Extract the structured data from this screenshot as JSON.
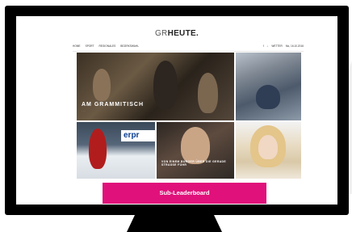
{
  "site": {
    "logo_prefix": "GR",
    "logo_main": "HEUTE."
  },
  "nav": {
    "items": [
      "HOME",
      "SPORT",
      "REGIONALES",
      "BEZIRKSWAHL"
    ],
    "right_icons": [
      "facebook-icon",
      "search-icon"
    ],
    "weather": "WETTER",
    "user": "Mo, 16.10.2016"
  },
  "tiles": [
    {
      "title": "AM GRAMMITISCH",
      "meta": "..."
    },
    {
      "title": "",
      "meta": ""
    },
    {
      "title": "",
      "meta": ""
    },
    {
      "title": "VON EINEM BURGER ÜBER DIE GERADE STRASSE FÜHR",
      "meta": ""
    },
    {
      "title": "",
      "meta": ""
    }
  ],
  "tile3_sign": "erpr",
  "ad": {
    "label": "Sub-Leaderboard",
    "color": "#e0117a"
  }
}
